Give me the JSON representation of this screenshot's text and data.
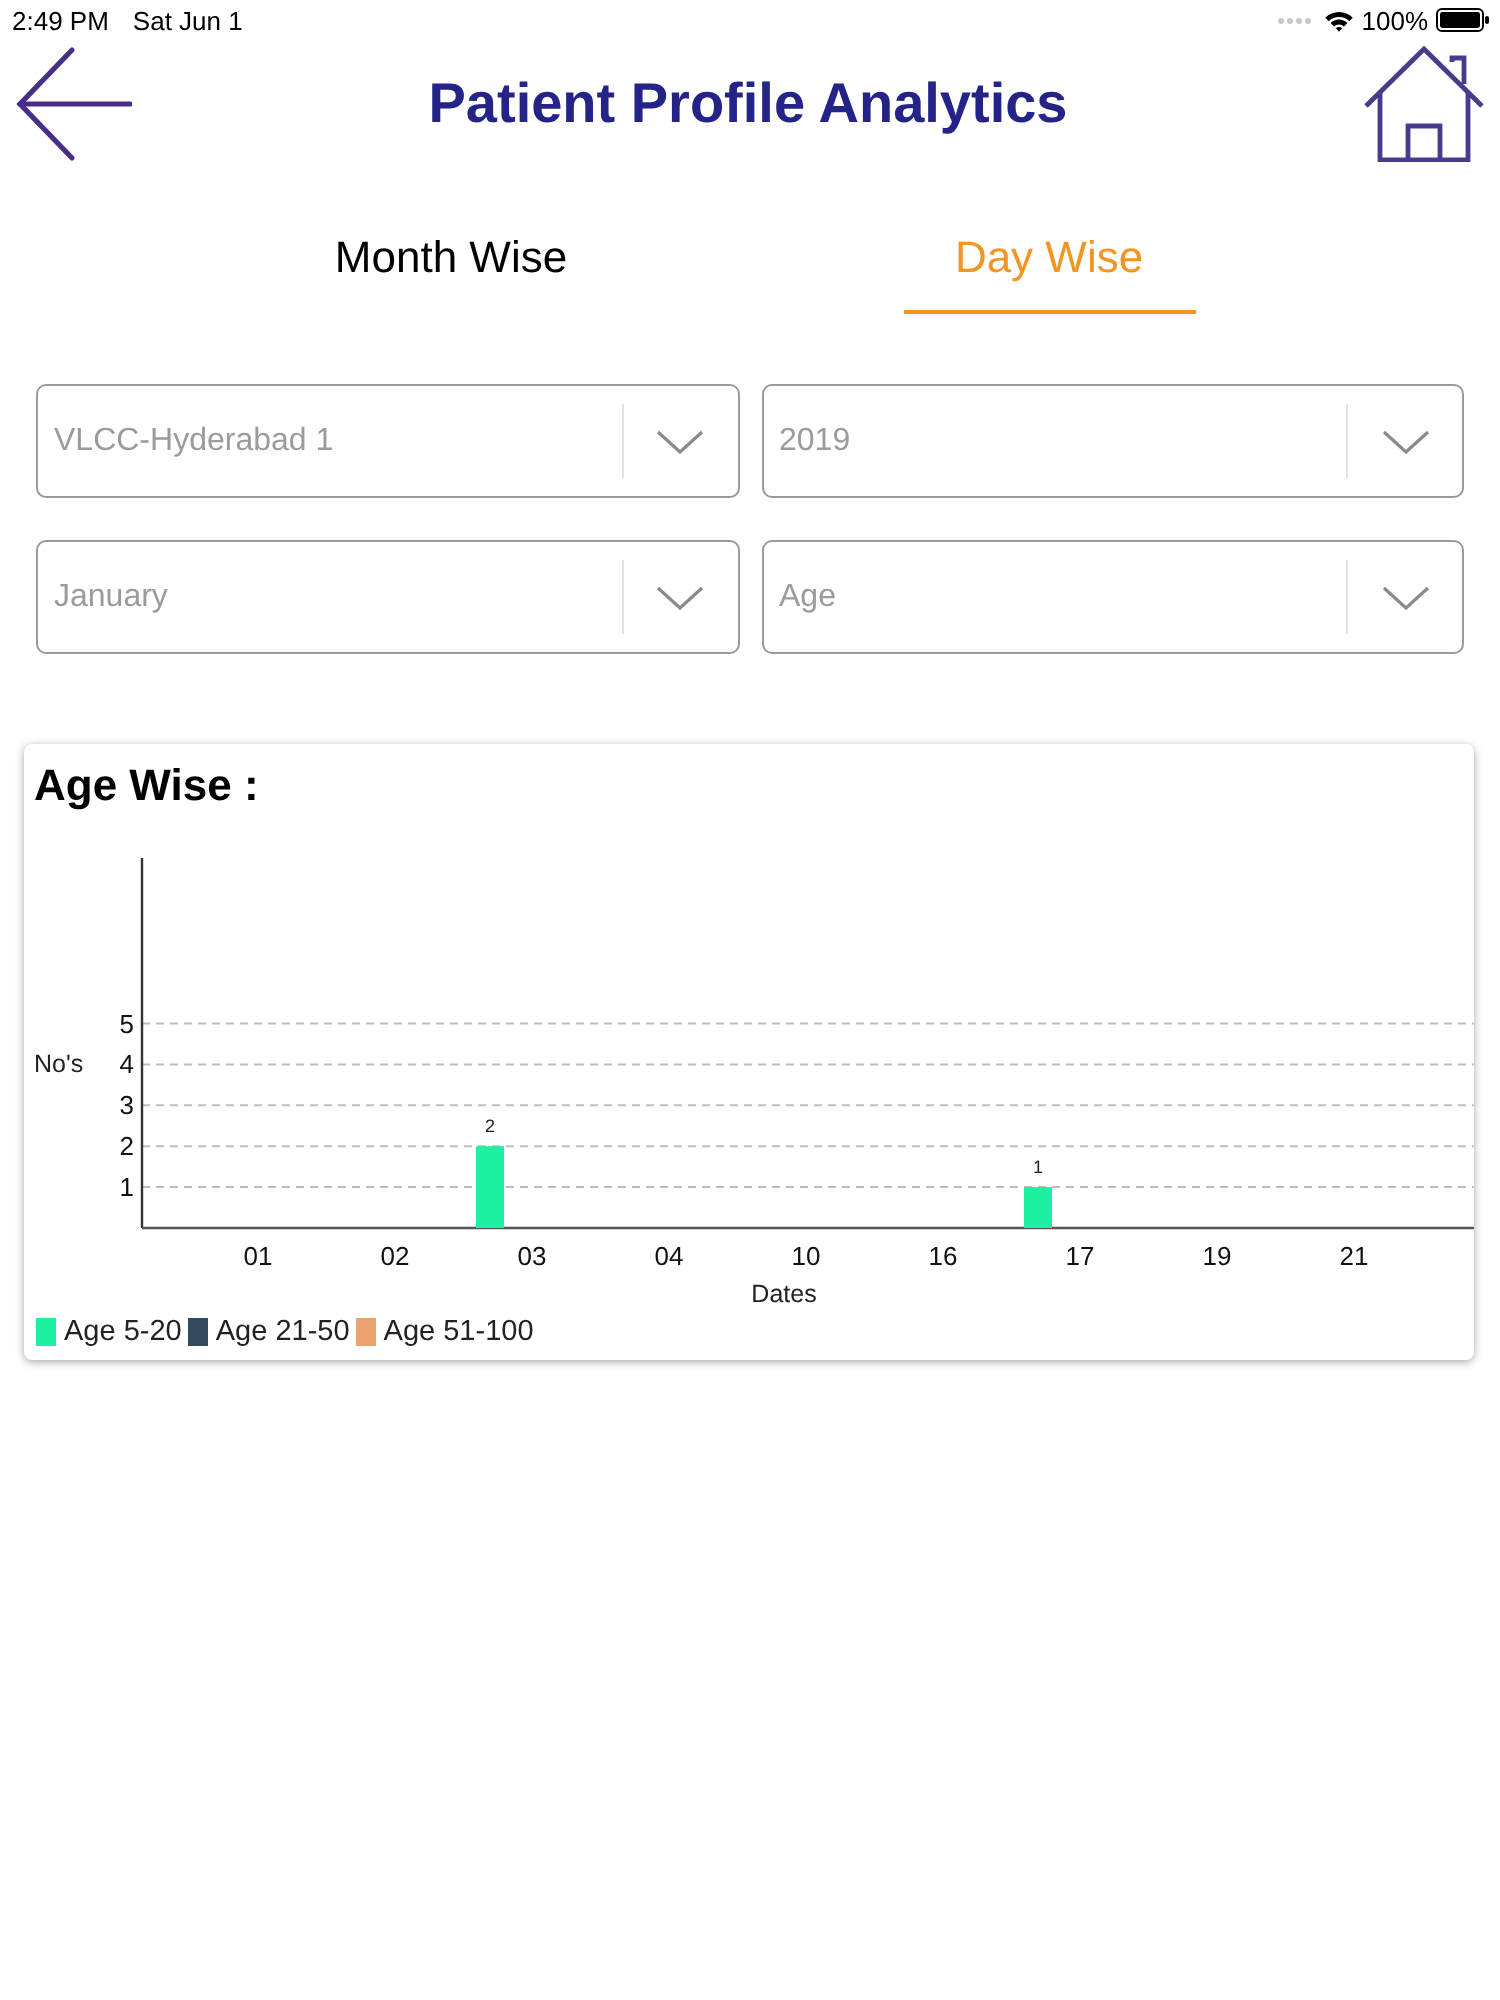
{
  "status_bar": {
    "time": "2:49 PM",
    "date": "Sat Jun 1",
    "battery": "100%"
  },
  "header": {
    "title": "Patient Profile Analytics"
  },
  "tabs": [
    {
      "label": "Month Wise",
      "selected": false
    },
    {
      "label": "Day Wise",
      "selected": true
    }
  ],
  "filters": [
    {
      "value": "VLCC-Hyderabad 1"
    },
    {
      "value": "2019"
    },
    {
      "value": "January"
    },
    {
      "value": "Age"
    }
  ],
  "chart_card": {
    "chart_data": {
      "type": "bar",
      "title": "Age Wise :",
      "xlabel": "Dates",
      "ylabel": "No's",
      "categories": [
        "01",
        "02",
        "03",
        "04",
        "10",
        "16",
        "17",
        "19",
        "21"
      ],
      "series": [
        {
          "name": "Age 5-20",
          "color": "#1ef0a2",
          "values": [
            0,
            0,
            2,
            0,
            0,
            0,
            1,
            0,
            0
          ]
        },
        {
          "name": "Age 21-50",
          "color": "#34495e",
          "values": [
            0,
            0,
            0,
            0,
            0,
            0,
            0,
            0,
            0
          ]
        },
        {
          "name": "Age 51-100",
          "color": "#eca36f",
          "values": [
            0,
            0,
            0,
            0,
            0,
            0,
            0,
            0,
            0
          ]
        }
      ],
      "ylim": [
        0,
        9
      ],
      "yticks": [
        1,
        2,
        3,
        4,
        5
      ],
      "grid": true,
      "value_labels": [
        [
          null,
          null,
          "2",
          null,
          null,
          null,
          "1",
          null,
          null
        ],
        [
          null,
          null,
          null,
          null,
          null,
          null,
          null,
          null,
          null
        ],
        [
          null,
          null,
          null,
          null,
          null,
          null,
          null,
          null,
          null
        ]
      ]
    }
  }
}
